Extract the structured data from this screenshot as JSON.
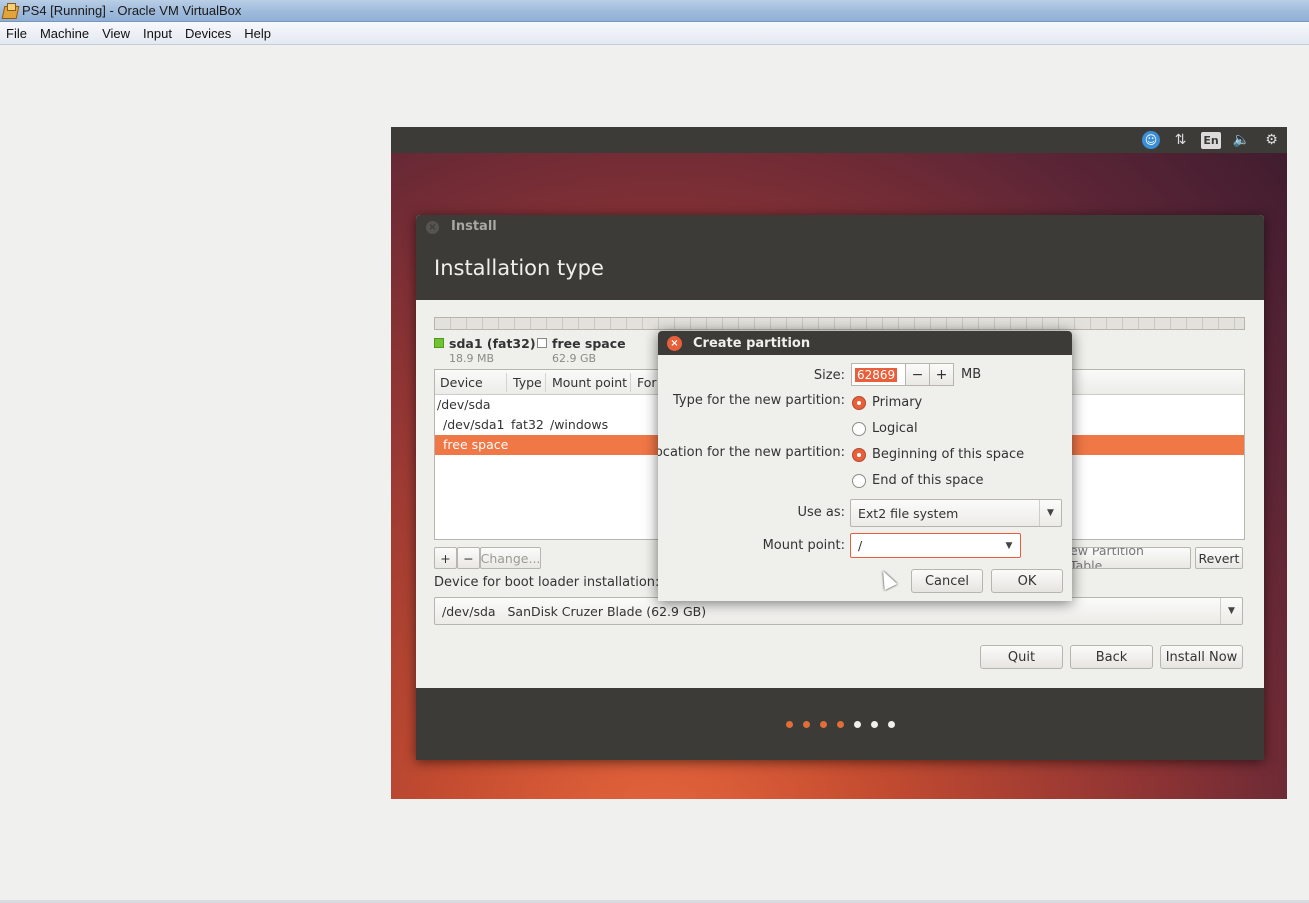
{
  "host": {
    "title": "PS4 [Running] - Oracle VM VirtualBox",
    "menu": [
      "File",
      "Machine",
      "View",
      "Input",
      "Devices",
      "Help"
    ]
  },
  "guest": {
    "tray": {
      "accessibility_icon": "accessibility-icon",
      "network_icon": "network-updown-icon",
      "keyboard_label": "En",
      "volume_icon": "volume-icon",
      "settings_icon": "gear-icon"
    },
    "installer": {
      "window_title": "Install",
      "page_title": "Installation type",
      "legend": [
        {
          "name": "sda1 (fat32)",
          "size": "18.9 MB",
          "color": "#6fc431"
        },
        {
          "name": "free space",
          "size": "62.9 GB",
          "color": "#ffffff"
        }
      ],
      "table": {
        "headers": [
          "Device",
          "Type",
          "Mount point",
          "For"
        ],
        "rows": [
          {
            "device": "/dev/sda",
            "type": "",
            "mount": ""
          },
          {
            "device": "/dev/sda1",
            "type": "fat32",
            "mount": "/windows"
          },
          {
            "device": "free space",
            "type": "",
            "mount": "",
            "selected": true
          }
        ]
      },
      "buttons": {
        "add": "+",
        "remove": "−",
        "change": "Change...",
        "new_table": "ew Partition Table...",
        "revert": "Revert",
        "quit": "Quit",
        "back": "Back",
        "install_now": "Install Now"
      },
      "boot_loader_label": "Device for boot loader installation:",
      "boot_loader_value": "/dev/sda   SanDisk Cruzer Blade (62.9 GB)",
      "progress": {
        "total_steps": 7,
        "completed_steps": 4
      }
    },
    "dialog": {
      "title": "Create partition",
      "size_label": "Size:",
      "size_value": "62869",
      "size_unit": "MB",
      "type_label": "Type for the new partition:",
      "type_options": [
        "Primary",
        "Logical"
      ],
      "type_selected": "Primary",
      "location_label": "Location for the new partition:",
      "location_options": [
        "Beginning of this space",
        "End of this space"
      ],
      "location_selected": "Beginning of this space",
      "use_as_label": "Use as:",
      "use_as_value": "Ext2 file system",
      "mount_label": "Mount point:",
      "mount_value": "/",
      "cancel": "Cancel",
      "ok": "OK"
    }
  },
  "colors": {
    "accent": "#e8603b",
    "selection": "#f07746",
    "panel": "#3c3b37"
  }
}
